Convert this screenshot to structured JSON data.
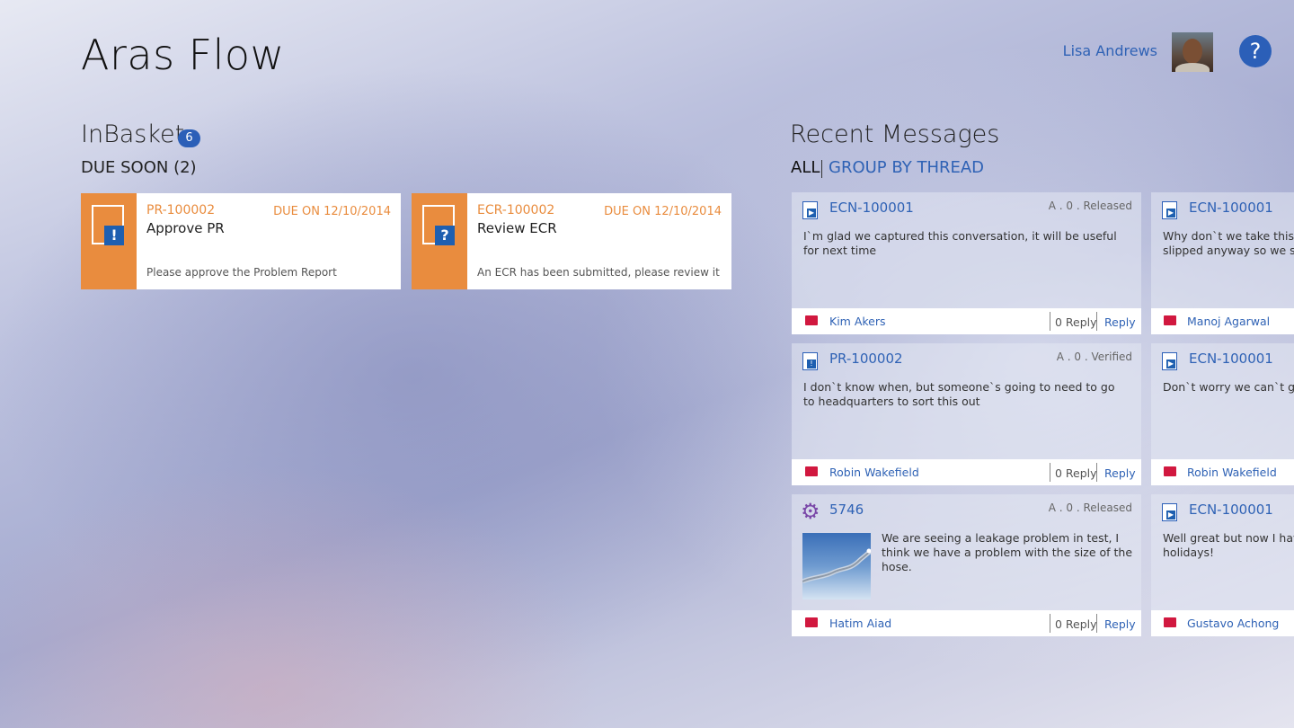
{
  "app": {
    "title": "Aras Flow"
  },
  "user": {
    "name": "Lisa Andrews"
  },
  "help": {
    "label": "?"
  },
  "inbasket": {
    "title": "InBasket",
    "count": "6",
    "due_soon": "DUE SOON (2)",
    "tasks": [
      {
        "id": "PR-100002",
        "due": "DUE ON 12/10/2014",
        "name": "Approve PR",
        "description": "Please approve the Problem Report",
        "icon": "!"
      },
      {
        "id": "ECR-100002",
        "due": "DUE ON 12/10/2014",
        "name": "Review ECR",
        "description": "An ECR has been submitted, please review it",
        "icon": "?"
      }
    ]
  },
  "recent": {
    "title": "Recent Messages",
    "filters": {
      "all": "ALL",
      "group": "GROUP BY THREAD"
    },
    "messages": [
      {
        "id": "ECN-100001",
        "status": "A . 0 . Released",
        "text": "I`m glad we captured this conversation, it will be useful for next time",
        "author": "Kim Akers",
        "replies": "0 Reply",
        "reply": "Reply"
      },
      {
        "id": "PR-100002",
        "status": "A . 0 . Verified",
        "text": "I don`t know when, but someone`s going to need to go to headquarters to sort this out",
        "author": "Robin Wakefield",
        "replies": "0 Reply",
        "reply": "Reply"
      },
      {
        "id": "5746",
        "status": "A . 0 . Released",
        "text": "We are seeing a leakage problem in test, I think we have a problem with the size of the hose.",
        "author": "Hatim Aiad",
        "replies": "0 Reply",
        "reply": "Reply"
      }
    ],
    "messages_right": [
      {
        "id": "ECN-100001",
        "text1": "Why don`t we take this offli",
        "text2": "slipped anyway so we shou",
        "author": "Manoj Agarwal"
      },
      {
        "id": "ECN-100001",
        "text1": "Don`t worry we can`t get th",
        "text2": "",
        "author": "Robin Wakefield"
      },
      {
        "id": "ECN-100001",
        "text1": "Well great but now I have t",
        "text2": "holidays!",
        "author": "Gustavo Achong"
      }
    ]
  },
  "colors": {
    "accent": "#2b5fb8",
    "task_orange": "#e98c3e",
    "flag_red": "#d1183f"
  }
}
